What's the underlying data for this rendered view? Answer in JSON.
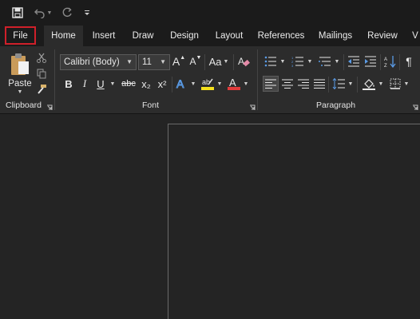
{
  "tabs": [
    "File",
    "Home",
    "Insert",
    "Draw",
    "Design",
    "Layout",
    "References",
    "Mailings",
    "Review",
    "V"
  ],
  "ribbon": {
    "paste_label": "Paste",
    "font_name": "Calibri (Body)",
    "font_size": "11",
    "aa_label": "Aa",
    "bold": "B",
    "italic": "I",
    "underline": "U",
    "strike": "abc",
    "subscript": "x₂",
    "superscript": "x²",
    "grow_font": "A",
    "shrink_font": "A",
    "groups": {
      "clipboard": "Clipboard",
      "font": "Font",
      "paragraph": "Paragraph"
    }
  },
  "colors": {
    "highlight": "#f5e11d",
    "font_color": "#e23c3c",
    "file_outline": "#d0202a"
  }
}
